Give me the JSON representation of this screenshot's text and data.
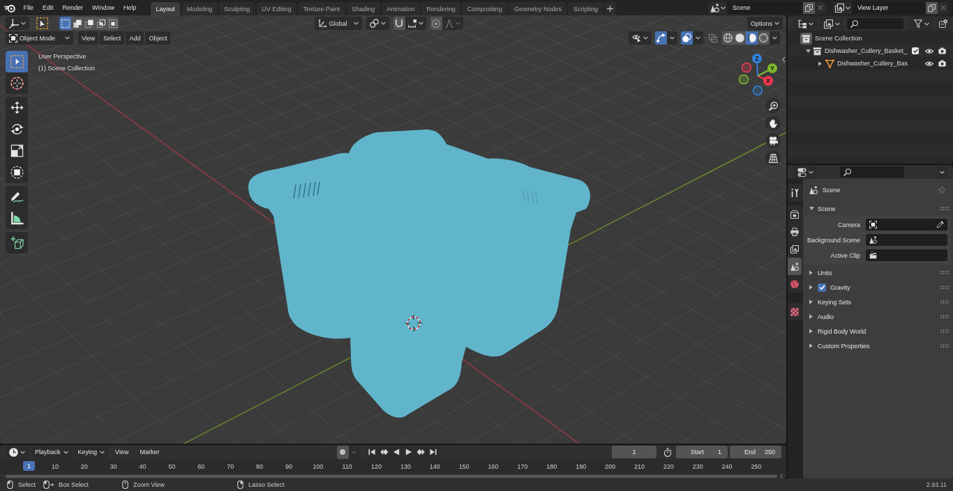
{
  "top_bar": {
    "menus": [
      "File",
      "Edit",
      "Render",
      "Window",
      "Help"
    ],
    "workspaces": [
      {
        "label": "Layout",
        "selected": true
      },
      {
        "label": "Modeling",
        "selected": false
      },
      {
        "label": "Sculpting",
        "selected": false
      },
      {
        "label": "UV Editing",
        "selected": false
      },
      {
        "label": "Texture Paint",
        "selected": false
      },
      {
        "label": "Shading",
        "selected": false
      },
      {
        "label": "Animation",
        "selected": false
      },
      {
        "label": "Rendering",
        "selected": false
      },
      {
        "label": "Compositing",
        "selected": false
      },
      {
        "label": "Geometry Nodes",
        "selected": false
      },
      {
        "label": "Scripting",
        "selected": false
      }
    ],
    "scene": "Scene",
    "view_layer": "View Layer"
  },
  "viewport": {
    "header": {
      "select_modes": [
        {
          "selected": true
        },
        {
          "selected": false
        },
        {
          "selected": false
        },
        {
          "selected": false
        },
        {
          "selected": false
        }
      ],
      "orientation": "Global",
      "options": "Options",
      "mode": "Object Mode",
      "menus": [
        "View",
        "Select",
        "Add",
        "Object"
      ],
      "gizmos": {
        "on": true
      },
      "overlays": {
        "on": true
      },
      "xray": {
        "on": false
      },
      "shading_modes": [
        {
          "selected": false
        },
        {
          "selected": false
        },
        {
          "selected": true
        },
        {
          "selected": false
        }
      ]
    },
    "overlay_text": [
      "User Perspective",
      "(1) Scene Collection"
    ],
    "tool_groups": [
      {
        "tools": [
          {
            "selected": true
          },
          {
            "selected": false
          }
        ]
      },
      {
        "tools": [
          {
            "selected": false
          },
          {
            "selected": false
          },
          {
            "selected": false
          },
          {
            "selected": false
          }
        ]
      },
      {
        "tools": [
          {
            "selected": false
          },
          {
            "selected": false
          }
        ]
      },
      {
        "tools": [
          {
            "selected": false
          }
        ]
      }
    ],
    "navigation_gizmo": {
      "axes": [
        {
          "label": "X",
          "color": "#f2374f"
        },
        {
          "label": "Y",
          "color": "#80b82e"
        },
        {
          "label": "Z",
          "color": "#3283db"
        }
      ]
    }
  },
  "timeline": {
    "dropdowns": [
      "Playback",
      "Keying"
    ],
    "menus": [
      "View",
      "Marker"
    ],
    "current_frame": "1",
    "start": {
      "label": "Start",
      "value": "1"
    },
    "end": {
      "label": "End",
      "value": "250"
    },
    "ruler": {
      "playhead": "1",
      "ticks": [
        "10",
        "20",
        "30",
        "40",
        "50",
        "60",
        "70",
        "80",
        "90",
        "100",
        "110",
        "120",
        "130",
        "140",
        "150",
        "160",
        "170",
        "180",
        "190",
        "200",
        "210",
        "220",
        "230",
        "240",
        "250"
      ]
    }
  },
  "outliner": {
    "items": [
      {
        "label": "Scene Collection",
        "kind": "scene_collection",
        "children": [
          {
            "label": "Dishwasher_Cutlery_Basket_",
            "kind": "collection",
            "expanded": true,
            "checked": true,
            "children": [
              {
                "label": "Dishwasher_Cutlery_Bas",
                "kind": "object",
                "expanded": false
              }
            ]
          }
        ]
      }
    ]
  },
  "properties": {
    "tab_groups": [
      {
        "tabs": [
          {
            "selected": false
          }
        ]
      },
      {
        "tabs": [
          {
            "selected": false
          },
          {
            "selected": false
          },
          {
            "selected": false
          },
          {
            "selected": true
          },
          {
            "selected": false
          }
        ]
      },
      {
        "tabs": [
          {
            "selected": false
          }
        ]
      }
    ],
    "context": "Scene",
    "panels": [
      {
        "title": "Scene",
        "expanded": true,
        "fields": [
          {
            "label": "Camera",
            "kind": "object"
          },
          {
            "label": "Background Scene",
            "kind": "scene"
          },
          {
            "label": "Active Clip",
            "kind": "clip"
          }
        ]
      },
      {
        "title": "Units",
        "expanded": false
      },
      {
        "title": "Gravity",
        "expanded": false,
        "checked": true
      },
      {
        "title": "Keying Sets",
        "expanded": false
      },
      {
        "title": "Audio",
        "expanded": false
      },
      {
        "title": "Rigid Body World",
        "expanded": false
      },
      {
        "title": "Custom Properties",
        "expanded": false
      }
    ]
  },
  "status_bar": {
    "hints": [
      "Select",
      "Box Select",
      "Zoom View",
      "Lasso Select"
    ],
    "version": "2.93.11"
  }
}
